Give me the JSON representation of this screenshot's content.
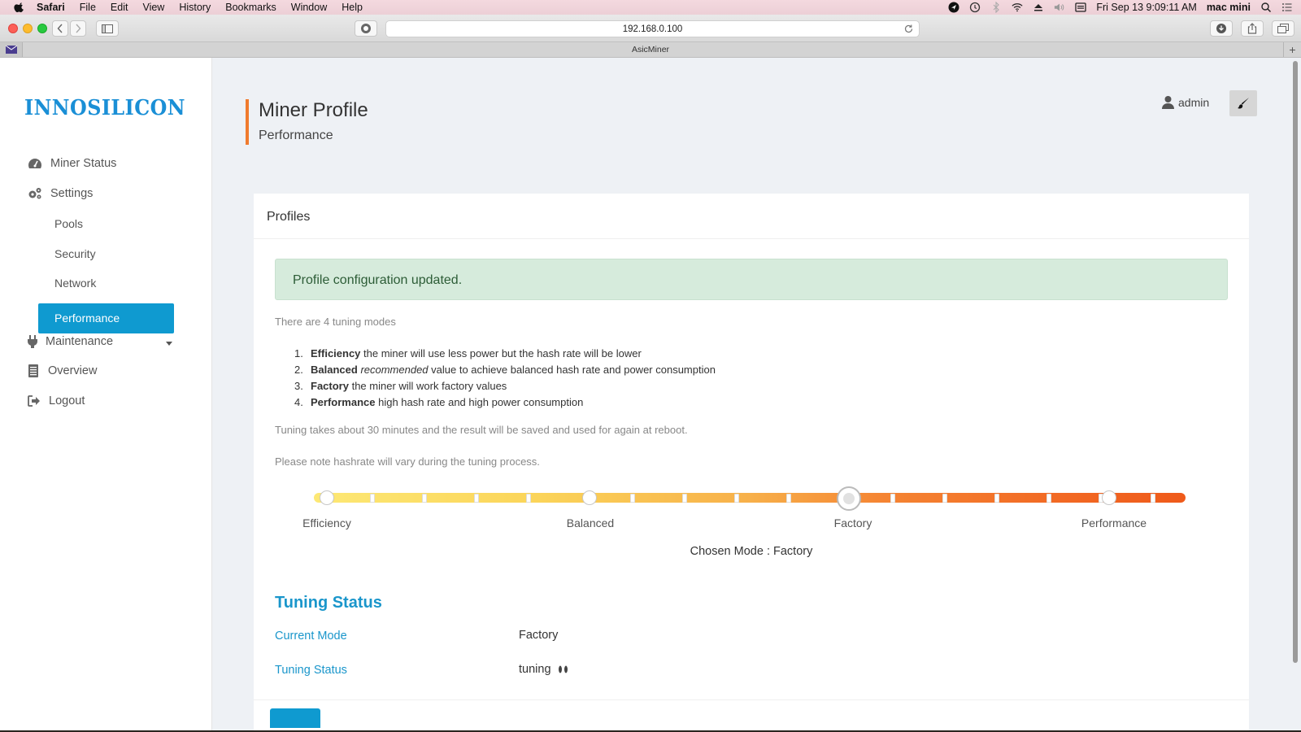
{
  "menubar": {
    "items": [
      "Safari",
      "File",
      "Edit",
      "View",
      "History",
      "Bookmarks",
      "Window",
      "Help"
    ],
    "datetime": "Fri Sep 13  9:09:11 AM",
    "computer_name": "mac mini"
  },
  "browser": {
    "url": "192.168.0.100",
    "tab_title": "AsicMiner"
  },
  "sidebar": {
    "logo_text": "INNOSILICON",
    "items": [
      {
        "label": "Miner Status",
        "icon": "dashboard-icon"
      },
      {
        "label": "Settings",
        "icon": "gears-icon"
      },
      {
        "label": "Pools"
      },
      {
        "label": "Security"
      },
      {
        "label": "Network"
      },
      {
        "label": "Performance",
        "active": true
      },
      {
        "label": "Maintenance",
        "icon": "plug-icon"
      },
      {
        "label": "Overview",
        "icon": "file-icon"
      },
      {
        "label": "Logout",
        "icon": "sign-out-icon"
      }
    ]
  },
  "header": {
    "title": "Miner Profile",
    "subtitle": "Performance",
    "user": "admin"
  },
  "profiles": {
    "card_title": "Profiles",
    "alert": "Profile configuration updated.",
    "intro": "There are 4 tuning modes",
    "modes": [
      {
        "num": "1.",
        "name": "Efficiency",
        "em": "",
        "desc": " the miner will use less power but the hash rate will be lower"
      },
      {
        "num": "2.",
        "name": "Balanced",
        "em": "recommended",
        "desc": " value to achieve balanced hash rate and power consumption"
      },
      {
        "num": "3.",
        "name": "Factory",
        "em": "",
        "desc": " the miner will work factory values"
      },
      {
        "num": "4.",
        "name": "Performance",
        "em": "",
        "desc": " high hash rate and high power consumption"
      }
    ],
    "note1": "Tuning takes about 30 minutes and the result will be saved and used for again at reboot.",
    "note2": "Please note hashrate will vary during the tuning process.",
    "slider_labels": [
      "Efficiency",
      "Balanced",
      "Factory",
      "Performance"
    ],
    "slider_selected_index": 2,
    "chosen_mode": "Chosen Mode : Factory"
  },
  "tuning": {
    "title": "Tuning Status",
    "current_mode_label": "Current Mode",
    "current_mode_value": "Factory",
    "status_label": "Tuning Status",
    "status_value": "tuning"
  },
  "colors": {
    "accent": "#0f9ad0",
    "header_bar": "#f07b2e",
    "alert_bg": "#d6ebdc"
  }
}
